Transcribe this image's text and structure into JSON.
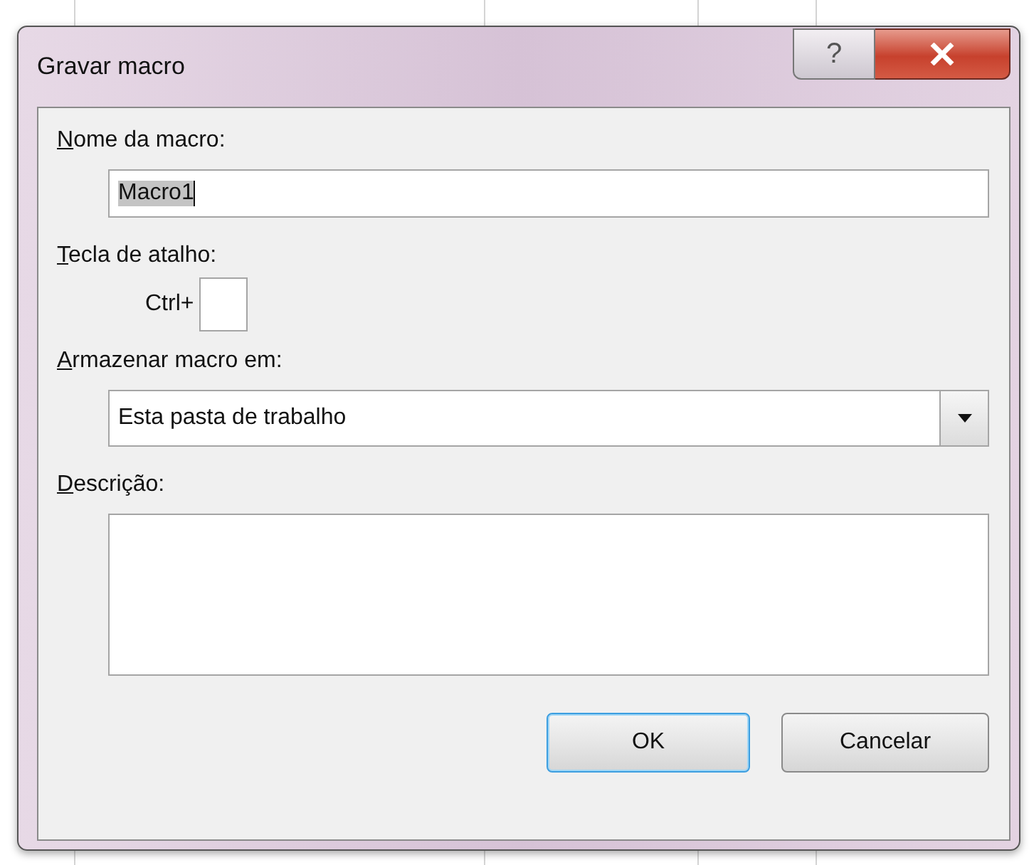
{
  "window": {
    "title": "Gravar macro",
    "help_button": "?"
  },
  "macro_name": {
    "label": "Nome da macro:",
    "value": "Macro1",
    "text_selected": true
  },
  "shortcut": {
    "label": "Tecla de atalho:",
    "prefix": "Ctrl+"
  },
  "store_in": {
    "label": "Armazenar macro em:",
    "value": "Esta pasta de trabalho"
  },
  "description": {
    "label": "Descrição:"
  },
  "buttons": [
    {
      "label": "OK",
      "default": true
    },
    {
      "label": "Cancelar",
      "default": false
    }
  ]
}
